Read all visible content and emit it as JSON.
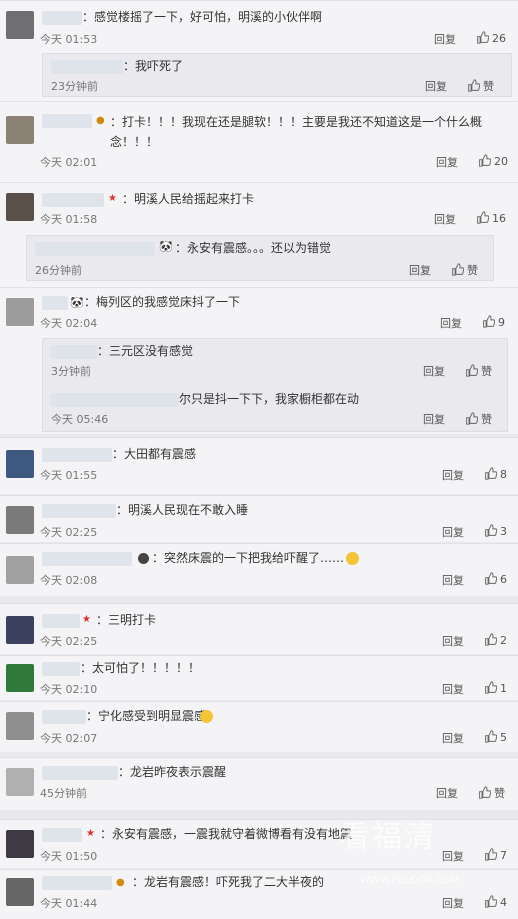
{
  "reply_label": "回复",
  "comments": [
    {
      "text": "：感觉楼摇了一下，好可怕，明溪的小伙伴啊",
      "time": "今天 01:53",
      "likes": "26",
      "sub_text": "：我吓死了",
      "sub_time": "23分钟前",
      "sub_like": "赞"
    },
    {
      "text": "：打卡！！！我现在还是腿软！！！主要是我还不知道这是一个什么概念！！！",
      "time": "今天 02:01",
      "likes": "20"
    },
    {
      "text": "：明溪人民给摇起来打卡",
      "time": "今天 01:58",
      "likes": "16",
      "sub_text": "：永安有震感。。。还以为错觉",
      "sub_time": "26分钟前",
      "sub_like": "赞"
    },
    {
      "text": "：梅列区的我感觉床抖了一下",
      "time": "今天 02:04",
      "likes": "9",
      "sub_text": "：三元区没有感觉",
      "sub_time": "3分钟前",
      "sub_like": "赞",
      "sub2_text": "尔只是抖一下下，我家橱柜都在动",
      "sub2_time": "今天 05:46",
      "sub2_like": "赞"
    },
    {
      "text": "：大田都有震感",
      "time": "今天 01:55",
      "likes": "8"
    },
    {
      "text": "：明溪人民现在不敢入睡",
      "time": "今天 02:25",
      "likes": "3"
    },
    {
      "text": "：突然床震的一下把我给吓醒了……",
      "time": "今天 02:08",
      "likes": "6"
    },
    {
      "text": "：三明打卡",
      "time": "今天 02:25",
      "likes": "2"
    },
    {
      "text": "：太可怕了！！！！！",
      "time": "今天 02:10",
      "likes": "1"
    },
    {
      "text": "：宁化感受到明显震感",
      "time": "今天 02:07",
      "likes": "5"
    },
    {
      "text": "：龙岩昨夜表示震醒",
      "time": "45分钟前",
      "likes": "赞"
    },
    {
      "text": "：永安有震感，一震我就守着微博看有没有地震",
      "time": "今天 01:50",
      "likes": "7"
    },
    {
      "text": "：龙岩有震感！吓死我了二大半夜的",
      "time": "今天 01:44",
      "likes": "4"
    }
  ],
  "watermark": {
    "title": "看福清",
    "url": "WWW.FQLOOK.COM"
  }
}
